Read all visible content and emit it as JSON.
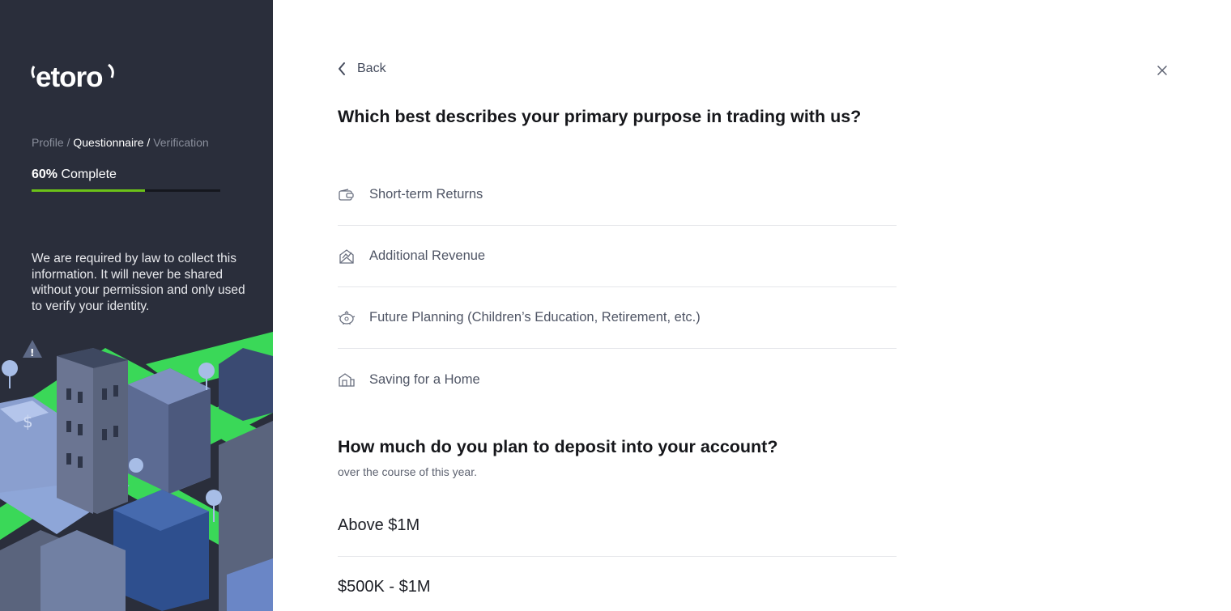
{
  "sidebar": {
    "logo_text": "etoro",
    "steps": {
      "profile": "Profile",
      "sep1": " / ",
      "questionnaire": "Questionnaire",
      "sep2": " / ",
      "verification": "Verification"
    },
    "progress": {
      "percent_label": "60%",
      "complete_label": " Complete",
      "value": 0.6
    },
    "legal_text": "We are required by law to collect this information. It will never be shared without your permission and only used to verify your identity."
  },
  "main": {
    "back_label": "Back",
    "question1": {
      "title": "Which best describes your primary purpose in trading with us?",
      "options": [
        {
          "label": "Short-term Returns",
          "icon": "wallet-icon"
        },
        {
          "label": "Additional Revenue",
          "icon": "envelope-chart-icon"
        },
        {
          "label": "Future Planning (Children’s Education, Retirement, etc.)",
          "icon": "piggy-bank-icon"
        },
        {
          "label": "Saving for a Home",
          "icon": "house-icon"
        }
      ]
    },
    "question2": {
      "title": "How much do you plan to deposit into your account?",
      "subtitle": "over the course of this year.",
      "options": [
        {
          "label": "Above $1M"
        },
        {
          "label": "$500K - $1M"
        }
      ]
    }
  },
  "colors": {
    "sidebar_bg": "#2a2e3b",
    "progress_accent": "#6cc218",
    "city_green": "#4ddb5e"
  }
}
